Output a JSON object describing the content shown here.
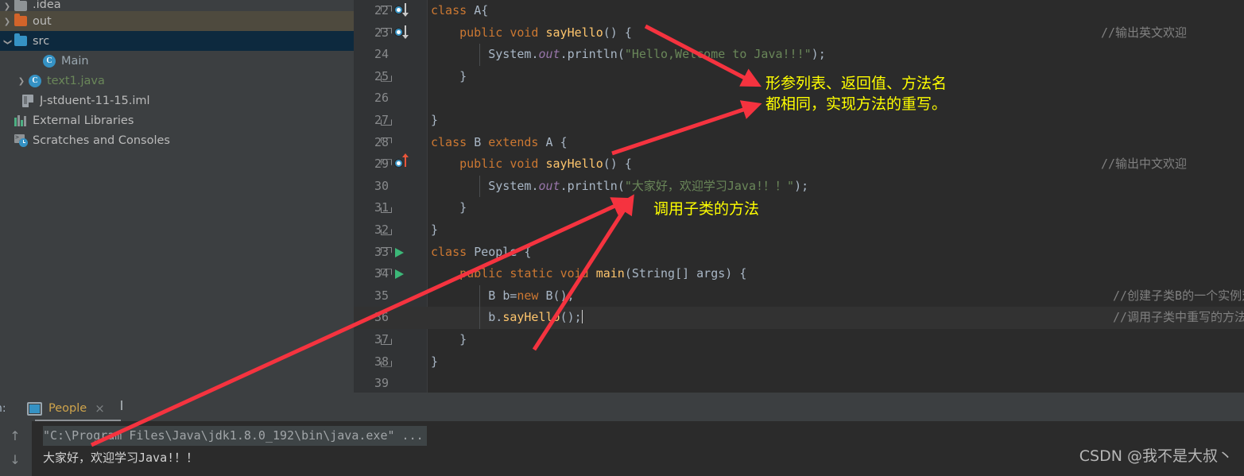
{
  "sidebar": {
    "items": [
      {
        "label": ".idea",
        "icon": "folder-grey-icon",
        "twisty": "right",
        "indent": 18,
        "state": "clipped"
      },
      {
        "label": "out",
        "icon": "folder-orange-icon",
        "twisty": "right",
        "indent": 18,
        "state": "selected-inactive"
      },
      {
        "label": "src",
        "icon": "folder-blue-icon",
        "twisty": "down",
        "indent": 18,
        "state": "selected-active"
      },
      {
        "label": "Main",
        "icon": "java-class-icon",
        "twisty": "none",
        "indent": 54,
        "state": "normal"
      },
      {
        "label": "text1.java",
        "icon": "java-class-icon",
        "twisty": "right",
        "indent": 36,
        "state": "normal"
      },
      {
        "label": "J-stduent-11-15.iml",
        "icon": "iml-file-icon",
        "twisty": "none",
        "indent": 28,
        "state": "normal"
      },
      {
        "label": "External Libraries",
        "icon": "libraries-icon",
        "twisty": "none",
        "indent": 4,
        "state": "normal"
      },
      {
        "label": "Scratches and Consoles",
        "icon": "scratches-icon",
        "twisty": "none",
        "indent": 2,
        "state": "normal"
      }
    ]
  },
  "editor": {
    "first_line": 22,
    "current_line": 36,
    "lines": [
      {
        "no": 22,
        "marker": "overridden-down",
        "fold": "open",
        "text": "class A{"
      },
      {
        "no": 23,
        "marker": "overridden-down",
        "fold": "open",
        "text": "    public void sayHello() {"
      },
      {
        "no": 24,
        "marker": "none",
        "fold": "none",
        "text": "        System.out.println(\"Hello,Welcome to Java!!!\");"
      },
      {
        "no": 25,
        "marker": "none",
        "fold": "close",
        "text": "    }"
      },
      {
        "no": 26,
        "marker": "none",
        "fold": "none",
        "text": ""
      },
      {
        "no": 27,
        "marker": "none",
        "fold": "close",
        "text": "}"
      },
      {
        "no": 28,
        "marker": "none",
        "fold": "open",
        "text": "class B extends A {"
      },
      {
        "no": 29,
        "marker": "overriding-up",
        "fold": "open",
        "text": "    public void sayHello() {"
      },
      {
        "no": 30,
        "marker": "none",
        "fold": "none",
        "text": "        System.out.println(\"大家好，欢迎学习Java!！！\");"
      },
      {
        "no": 31,
        "marker": "none",
        "fold": "close",
        "text": "    }"
      },
      {
        "no": 32,
        "marker": "none",
        "fold": "close",
        "text": "}"
      },
      {
        "no": 33,
        "marker": "run",
        "fold": "open",
        "text": "class People {"
      },
      {
        "no": 34,
        "marker": "run",
        "fold": "open",
        "text": "    public static void main(String[] args) {"
      },
      {
        "no": 35,
        "marker": "none",
        "fold": "none",
        "text": "        B b=new B();"
      },
      {
        "no": 36,
        "marker": "none",
        "fold": "none",
        "text": "        b.sayHello();"
      },
      {
        "no": 37,
        "marker": "none",
        "fold": "close",
        "text": "    }"
      },
      {
        "no": 38,
        "marker": "none",
        "fold": "close",
        "text": "}"
      },
      {
        "no": 39,
        "marker": "none",
        "fold": "none",
        "text": ""
      }
    ],
    "trailing_comments": [
      {
        "line": 23,
        "text": "//输出英文欢迎"
      },
      {
        "line": 29,
        "text": "//输出中文欢迎"
      },
      {
        "line": 35,
        "text": "//创建子类B的一个实例对象，使用默认构造方法"
      },
      {
        "line": 36,
        "text": "//调用子类中重写的方法"
      }
    ]
  },
  "console": {
    "tool_window_label": "n:",
    "tab_label": "People",
    "tab_close": "×",
    "scroll_up": "↑",
    "scroll_down": "↓",
    "command_line": "\"C:\\Program Files\\Java\\jdk1.8.0_192\\bin\\java.exe\" ...",
    "output_line": "大家好，欢迎学习Java!！！"
  },
  "annotations": {
    "note1_line1": "形参列表、返回值、方法名",
    "note1_line2": "都相同，实现方法的重写。",
    "note2": "调用子类的方法",
    "arrow_color": "#f5333f"
  },
  "watermark": "CSDN @我不是大叔丶",
  "colors": {
    "editor_bg": "#2b2b2b",
    "panel_bg": "#3c3f41",
    "gutter_bg": "#313335",
    "selection_active": "#0d293e",
    "selection_inactive": "#4e4a3e",
    "keyword": "#cc7832",
    "string": "#6a8759",
    "method": "#ffc66d",
    "field": "#9876aa",
    "comment": "#808080",
    "annotation_yellow": "#ffff00"
  }
}
